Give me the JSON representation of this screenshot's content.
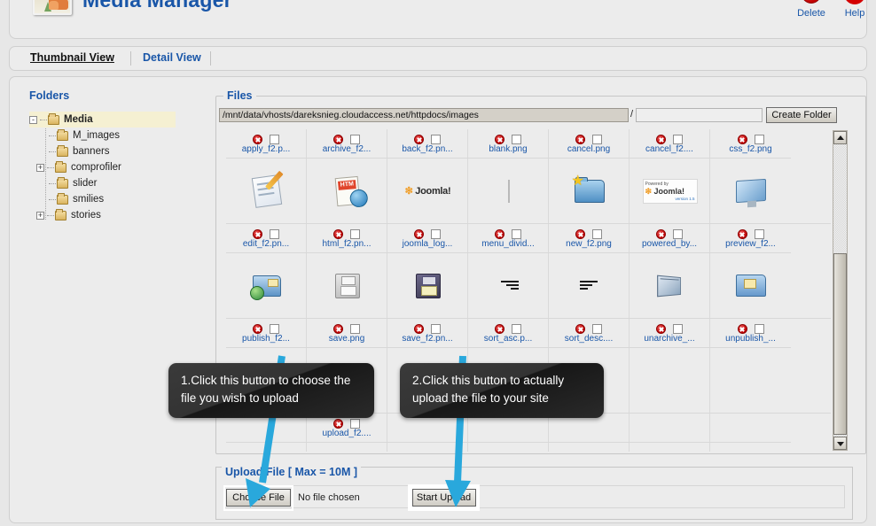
{
  "header": {
    "title": "Media Manager",
    "icon": "media-manager-icon",
    "toolbar": [
      {
        "label": "Delete",
        "icon": "delete-icon"
      },
      {
        "label": "Help",
        "icon": "help-icon"
      }
    ]
  },
  "tabs": [
    {
      "label": "Thumbnail View",
      "active": true
    },
    {
      "label": "Detail View",
      "active": false
    }
  ],
  "folders": {
    "title": "Folders",
    "items": [
      {
        "label": "Media",
        "toggle": "-",
        "level": 0
      },
      {
        "label": "M_images",
        "toggle": "",
        "level": 1
      },
      {
        "label": "banners",
        "toggle": "",
        "level": 1
      },
      {
        "label": "comprofiler",
        "toggle": "+",
        "level": 1
      },
      {
        "label": "slider",
        "toggle": "",
        "level": 1
      },
      {
        "label": "smilies",
        "toggle": "",
        "level": 1
      },
      {
        "label": "stories",
        "toggle": "+",
        "level": 1
      }
    ]
  },
  "files": {
    "legend": "Files",
    "path": "/mnt/data/vhosts/dareksnieg.cloudaccess.net/httpdocs/images",
    "separator": "/",
    "new_folder_value": "",
    "new_folder_placeholder": "",
    "create_folder_label": "Create Folder",
    "rows": [
      [
        {
          "name": "apply_f2.p...",
          "art": "doc-pencil"
        },
        {
          "name": "archive_f2...",
          "art": "html-globe"
        },
        {
          "name": "back_f2.pn...",
          "art": "joomla-logo"
        },
        {
          "name": "blank.png",
          "art": "vline"
        },
        {
          "name": "cancel.png",
          "art": "folder-star"
        },
        {
          "name": "cancel_f2....",
          "art": "powered-by-joomla"
        },
        {
          "name": "css_f2.png",
          "art": "monitor"
        }
      ],
      [
        {
          "name": "edit_f2.pn...",
          "art": "folder-globe"
        },
        {
          "name": "html_f2.pn...",
          "art": "floppy-gray"
        },
        {
          "name": "joomla_log...",
          "art": "floppy-dark"
        },
        {
          "name": "menu_divid...",
          "art": "divider-right"
        },
        {
          "name": "new_f2.png",
          "art": "divider-left"
        },
        {
          "name": "powered_by...",
          "art": "envelope"
        },
        {
          "name": "preview_f2...",
          "art": "folder-note"
        }
      ],
      [
        {
          "name": "publish_f2...",
          "art": ""
        },
        {
          "name": "save.png",
          "art": ""
        },
        {
          "name": "save_f2.pn...",
          "art": ""
        },
        {
          "name": "sort_asc.p...",
          "art": ""
        },
        {
          "name": "sort_desc....",
          "art": ""
        },
        {
          "name": "unarchive_...",
          "art": ""
        },
        {
          "name": "unpublish_...",
          "art": ""
        }
      ],
      [
        {
          "name": "",
          "art": ""
        },
        {
          "name": "upload_f2....",
          "art": ""
        },
        {
          "name": "",
          "art": ""
        },
        {
          "name": "",
          "art": ""
        },
        {
          "name": "",
          "art": ""
        },
        {
          "name": "",
          "art": ""
        },
        {
          "name": "",
          "art": ""
        }
      ]
    ]
  },
  "upload": {
    "legend": "Upload File [ Max = 10M ]",
    "choose_label": "Choose File",
    "no_file_text": "No file chosen",
    "start_label": "Start Upload"
  },
  "callouts": [
    {
      "text": "1.Click this button to choose the file you wish to upload"
    },
    {
      "text": "2.Click this button to actually upload the file to your site"
    }
  ],
  "colors": {
    "accent_blue": "#1956a8",
    "arrow_blue": "#29a8dc",
    "delete_red": "#c20000",
    "tree_highlight": "#f5f0d2",
    "page_bg": "#e7e7e7"
  }
}
